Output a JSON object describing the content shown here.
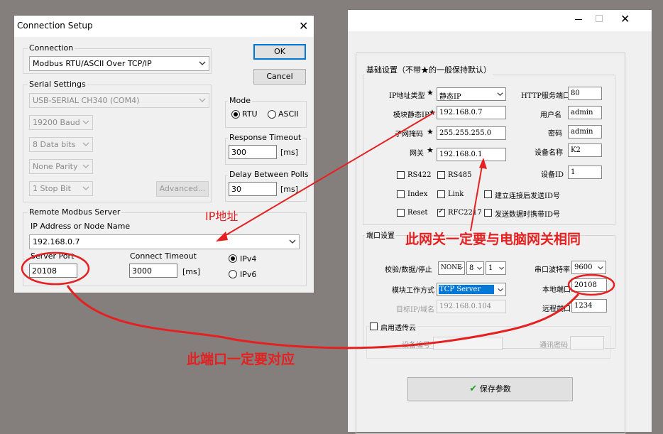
{
  "left": {
    "title": "Connection Setup",
    "ok": "OK",
    "cancel": "Cancel",
    "connection_label": "Connection",
    "connection_value": "Modbus RTU/ASCII Over TCP/IP",
    "serial_label": "Serial Settings",
    "com_port": "USB-SERIAL CH340 (COM4)",
    "baud": "19200 Baud",
    "data_bits": "8 Data bits",
    "parity": "None Parity",
    "stop_bits": "1 Stop Bit",
    "advanced": "Advanced...",
    "mode_label": "Mode",
    "mode_rtu": "RTU",
    "mode_ascii": "ASCII",
    "response_label": "Response Timeout",
    "response_value": "300",
    "delay_label": "Delay Between Polls",
    "delay_value": "30",
    "ms": "[ms]",
    "remote_label": "Remote Modbus Server",
    "ip_label": "IP Address or Node Name",
    "ip_value": "192.168.0.7",
    "server_port_label": "Server Port",
    "server_port_value": "20108",
    "connect_timeout_label": "Connect Timeout",
    "connect_timeout_value": "3000",
    "ipv4": "IPv4",
    "ipv6": "IPv6"
  },
  "right": {
    "basic_label": "基础设置（不带★的一般保持默认）",
    "ip_type_label": "IP地址类型",
    "ip_type_value": "静态IP",
    "static_ip_label": "模块静态IP",
    "static_ip_value": "192.168.0.7",
    "mask_label": "子网掩码",
    "mask_value": "255.255.255.0",
    "gateway_label": "网关",
    "gateway_value": "192.168.0.1",
    "star": "★",
    "http_label": "HTTP服务端口",
    "http_value": "80",
    "user_label": "用户名",
    "user_value": "admin",
    "pwd_label": "密码",
    "pwd_value": "admin",
    "devname_label": "设备名称",
    "devname_value": "K2",
    "devid_label": "设备ID",
    "devid_value": "1",
    "cb_rs422": "RS422",
    "cb_rs485": "RS485",
    "cb_index": "Index",
    "cb_link": "Link",
    "cb_reset": "Reset",
    "cb_rfc": "RFC2217",
    "cb_conn_id": "建立连接后发送ID号",
    "cb_data_id": "发送数据时携带ID号",
    "port_label": "端口设置",
    "parity_label": "校验/数据/停止",
    "parity_value": "NONE",
    "databits_value": "8",
    "stopbits_value": "1",
    "baud_label": "串口波特率",
    "baud_value": "9600",
    "mode_label": "模块工作方式",
    "mode_value": "TCP Server",
    "local_port_label": "本地端口",
    "local_port_value": "20108",
    "target_label": "目标IP/域名",
    "target_value": "192.168.0.104",
    "remote_port_label": "远程端口",
    "remote_port_value": "1234",
    "cloud_label": "启用透传云",
    "device_no_label": "设备编号",
    "comm_pwd_label": "通讯密码",
    "save": "保存参数"
  },
  "annotations": {
    "ip": "IP地址",
    "gateway": "此网关一定要与电脑网关相同",
    "port": "此端口一定要对应"
  },
  "colors": {
    "accent": "#0078d7",
    "annotation": "#e52020",
    "selection": "#0078d7"
  }
}
